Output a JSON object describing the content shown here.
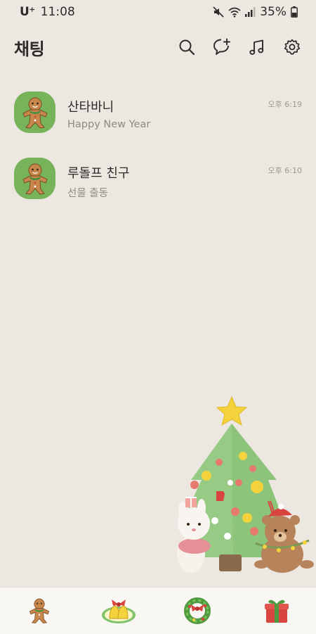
{
  "status": {
    "carrier": "U⁺",
    "time": "11:08",
    "battery": "35%"
  },
  "header": {
    "title": "채팅"
  },
  "chats": [
    {
      "name": "산타바니",
      "message": "Happy New Year",
      "time": "오후 6:19"
    },
    {
      "name": "루돌프 친구",
      "message": "선물 출동",
      "time": "오후 6:10"
    }
  ],
  "colors": {
    "background": "#ece8e1",
    "avatar": "#77b35a",
    "tree": "#8cc47a"
  },
  "icons": {
    "header": [
      "search-icon",
      "new-chat-icon",
      "music-icon",
      "settings-icon"
    ],
    "tabs": [
      "gingerbread-friends-icon",
      "bells-chats-icon",
      "wreath-view-icon",
      "gift-more-icon"
    ]
  }
}
